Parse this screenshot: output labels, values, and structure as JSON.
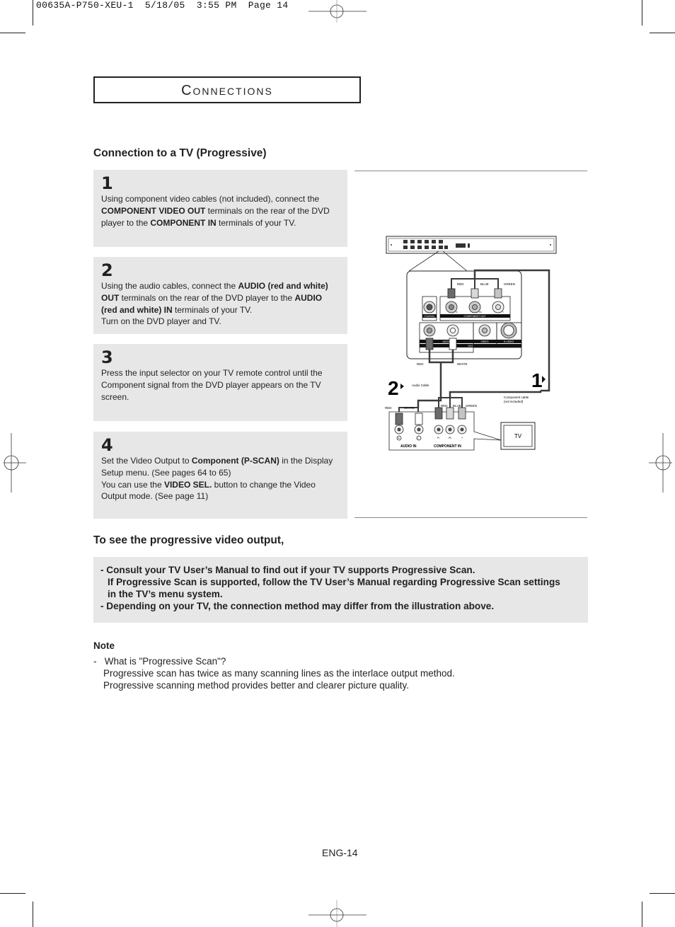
{
  "slug": "00635A-P750-XEU-1  5/18/05  3:55 PM  Page 14",
  "section_title": {
    "first": "C",
    "rest": "ONNECTIONS"
  },
  "heading": "Connection to a TV (Progressive)",
  "steps": [
    {
      "num": "1",
      "segments": [
        {
          "t": "Using component video cables (not included), connect the ",
          "b": false
        },
        {
          "t": "COMPONENT VIDEO OUT",
          "b": true
        },
        {
          "t": " terminals on the rear of the DVD player to the ",
          "b": false
        },
        {
          "t": "COMPONENT IN",
          "b": true
        },
        {
          "t": " terminals of your TV.",
          "b": false
        }
      ]
    },
    {
      "num": "2",
      "segments": [
        {
          "t": "Using the audio cables, connect the ",
          "b": false
        },
        {
          "t": "AUDIO (red and white) OUT",
          "b": true
        },
        {
          "t": " terminals on the rear of the DVD player to the ",
          "b": false
        },
        {
          "t": "AUDIO (red and white) IN",
          "b": true
        },
        {
          "t": " terminals of your TV.",
          "b": false
        },
        {
          "t": "\nTurn on the DVD player and TV.",
          "b": false
        }
      ]
    },
    {
      "num": "3",
      "segments": [
        {
          "t": "Press the input selector on your TV remote control until the Component signal from the DVD player appears on the TV screen.",
          "b": false
        }
      ]
    },
    {
      "num": "4",
      "segments": [
        {
          "t": "Set the Video Output to ",
          "b": false
        },
        {
          "t": "Component (P-SCAN)",
          "b": true
        },
        {
          "t": " in the Display Setup menu. (See pages 64 to 65)",
          "b": false
        },
        {
          "t": "\nYou can use the ",
          "b": false
        },
        {
          "t": "VIDEO SEL.",
          "b": true
        },
        {
          "t": " button to change the Video Output mode. (See page 11)",
          "b": false
        }
      ]
    }
  ],
  "diagram": {
    "labels": {
      "red": "RED",
      "blue": "BLUE",
      "green": "GREEN",
      "white": "WHITE",
      "coaxial": "COAXIAL",
      "component_out": "COMPONENT OUT",
      "audio": "AUDIO",
      "video": "VIDEO",
      "s_video": "S-VIDEO",
      "out": "OUT",
      "pr": "Pr",
      "pb": "Pb",
      "y": "Y",
      "audio_cable": "Audio Cable",
      "component_cable_1": "Component cable",
      "component_cable_2": "(not included)",
      "audio_in": "AUDIO IN",
      "component_in": "COMPONENT IN",
      "r": "R",
      "l": "L",
      "tv": "TV",
      "step1": "1",
      "step2": "2"
    },
    "colors": {
      "red_plug": "#6b6b6b",
      "blue_plug": "#d8d8d8",
      "green_plug": "#c4c4c4",
      "white_plug": "#ffffff",
      "cable": "#3a3a3a"
    }
  },
  "subheading": "To see the progressive video output,",
  "info_lines": [
    {
      "text": "- Consult your TV User’s Manual to find out if your TV supports Progressive Scan.",
      "indent": false
    },
    {
      "text": "If Progressive Scan is supported, follow the TV User’s Manual regarding Progressive Scan settings",
      "indent": true
    },
    {
      "text": "in the TV’s menu system.",
      "indent": true
    },
    {
      "text": "- Depending on your TV, the connection method may differ from the illustration above.",
      "indent": false
    }
  ],
  "note": {
    "title": "Note",
    "lines": [
      {
        "text": "-   What is \"Progressive Scan\"?",
        "indent": false
      },
      {
        "text": "Progressive scan has twice as many scanning lines as the interlace output method.",
        "indent": true
      },
      {
        "text": "Progressive scanning method provides better and clearer picture quality.",
        "indent": true
      }
    ]
  },
  "page_number": "ENG-14"
}
